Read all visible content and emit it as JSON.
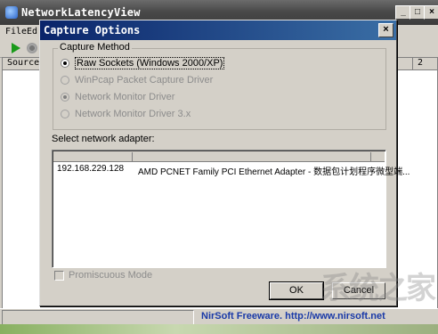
{
  "main_window": {
    "title": "NetworkLatencyView",
    "menu": [
      "File",
      "Ed"
    ],
    "column_headers": [
      "Source A",
      "2"
    ],
    "status_text": "NirSoft Freeware.  http://www.nirsoft.net",
    "caption_buttons": {
      "minimize": "_",
      "maximize": "□",
      "close": "×"
    }
  },
  "dialog": {
    "title": "Capture Options",
    "close_glyph": "×",
    "capture_method_label": "Capture Method",
    "capture_methods": [
      {
        "label": "Raw Sockets (Windows 2000/XP)",
        "selected": true,
        "enabled": true
      },
      {
        "label": "WinPcap Packet Capture Driver",
        "selected": false,
        "enabled": false
      },
      {
        "label": "Network Monitor Driver",
        "selected": true,
        "enabled": false
      },
      {
        "label": "Network Monitor Driver 3.x",
        "selected": false,
        "enabled": false
      }
    ],
    "adapter_label": "Select network adapter:",
    "adapters": [
      {
        "ip": "192.168.229.128",
        "name": "AMD PCNET Family PCI Ethernet Adapter - 数据包计划程序微型端..."
      }
    ],
    "promiscuous_label": "Promiscuous Mode",
    "ok_label": "OK",
    "cancel_label": "Cancel"
  },
  "watermark": "系统之家",
  "colors": {
    "dialog_title_start": "#0a246a",
    "dialog_title_end": "#3a6ea5",
    "status_link": "#1a3aa8"
  }
}
